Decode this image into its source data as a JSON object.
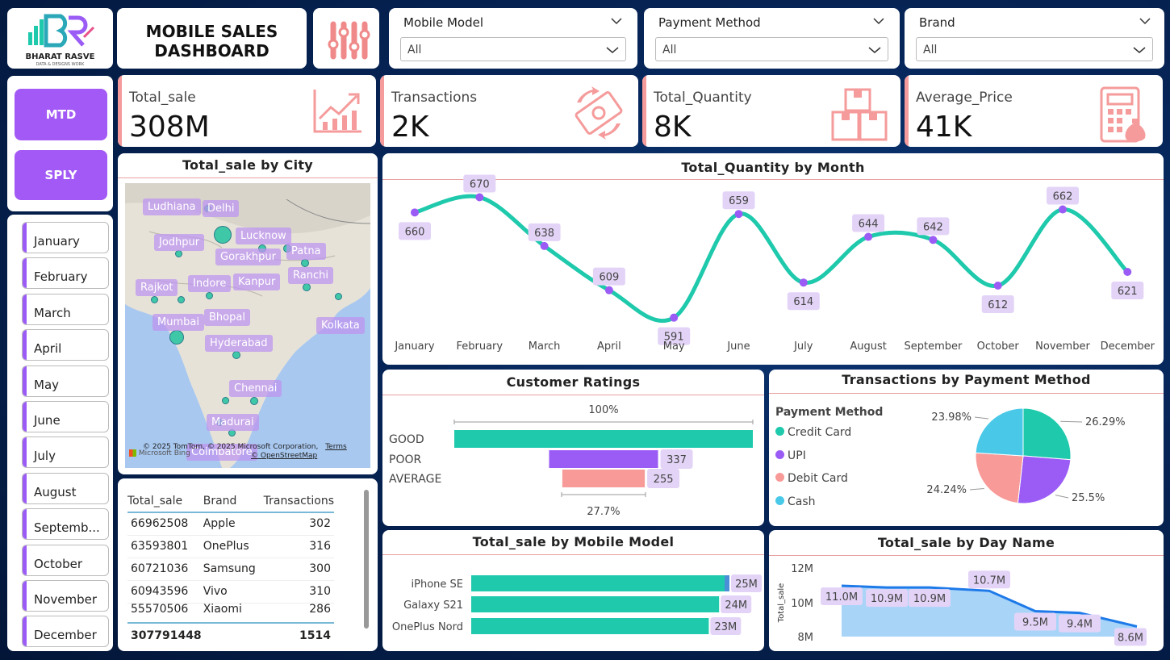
{
  "logo": {
    "brand": "BHARAT RASVE",
    "tagline": "DATA & DESIGNS WORK"
  },
  "header": {
    "title_line1": "MOBILE SALES",
    "title_line2": "DASHBOARD"
  },
  "filters": [
    {
      "label": "Mobile Model",
      "value": "All"
    },
    {
      "label": "Payment Method",
      "value": "All"
    },
    {
      "label": "Brand",
      "value": "All"
    }
  ],
  "buttons": {
    "mtd": "MTD",
    "sply": "SPLY"
  },
  "kpis": [
    {
      "name": "Total_sale",
      "value": "308M"
    },
    {
      "name": "Transactions",
      "value": "2K"
    },
    {
      "name": "Total_Quantity",
      "value": "8K"
    },
    {
      "name": "Average_Price",
      "value": "41K"
    }
  ],
  "months": [
    "January",
    "February",
    "March",
    "April",
    "May",
    "June",
    "July",
    "August",
    "Septemb...",
    "October",
    "November",
    "December"
  ],
  "map": {
    "title": "Total_sale by City",
    "cities": [
      "Ludhiana",
      "Delhi",
      "Jodhpur",
      "Lucknow",
      "Gorakhpur",
      "Patna",
      "Rajkot",
      "Indore",
      "Kanpur",
      "Ranchi",
      "Mumbai",
      "Bhopal",
      "Kolkata",
      "Hyderabad",
      "Chennai",
      "Madurai",
      "Coimbatore"
    ],
    "copyright": "© 2025 TomTom, © 2025 Microsoft Corporation,",
    "terms": "Terms",
    "osm": "© OpenStreetMap",
    "bing": "Microsoft Bing"
  },
  "table": {
    "headers": [
      "Total_sale",
      "Brand",
      "Transactions"
    ],
    "rows": [
      [
        "66962508",
        "Apple",
        "302"
      ],
      [
        "63593801",
        "OnePlus",
        "316"
      ],
      [
        "60721036",
        "Samsung",
        "300"
      ],
      [
        "60943596",
        "Vivo",
        "310"
      ],
      [
        "55570506",
        "Xiaomi",
        "286"
      ]
    ],
    "total": [
      "307791448",
      "",
      "1514"
    ]
  },
  "chart_data": [
    {
      "type": "line",
      "title": "Total_Quantity by Month",
      "categories": [
        "January",
        "February",
        "March",
        "April",
        "May",
        "June",
        "July",
        "August",
        "September",
        "October",
        "November",
        "December"
      ],
      "values": [
        660,
        670,
        638,
        609,
        591,
        659,
        614,
        644,
        642,
        612,
        662,
        621
      ]
    },
    {
      "type": "bar",
      "title": "Customer Ratings",
      "categories": [
        "GOOD",
        "POOR",
        "AVERAGE"
      ],
      "values": [
        null,
        337,
        255
      ],
      "top_label": "100%",
      "bottom_label": "27.7%"
    },
    {
      "type": "pie",
      "title": "Transactions by Payment Method",
      "legend_title": "Payment Method",
      "categories": [
        "Credit Card",
        "UPI",
        "Debit Card",
        "Cash"
      ],
      "values": [
        26.29,
        25.5,
        24.24,
        23.98
      ],
      "labels": [
        "26.29%",
        "25.5%",
        "24.24%",
        "23.98%"
      ],
      "colors": [
        "#1ec9ac",
        "#9b5cf6",
        "#f79a98",
        "#49c8e8"
      ]
    },
    {
      "type": "bar",
      "title": "Total_sale by Mobile Model",
      "categories": [
        "iPhone SE",
        "Galaxy S21",
        "OnePlus Nord"
      ],
      "values": [
        25,
        24,
        23
      ],
      "labels": [
        "25M",
        "24M",
        "23M"
      ]
    },
    {
      "type": "area",
      "title": "Total_sale by Day Name",
      "ylabel": "Total_sale",
      "ticks": [
        "12M",
        "10M",
        "8M"
      ],
      "ylim": [
        8,
        12
      ],
      "values": [
        11.0,
        10.9,
        10.9,
        10.7,
        9.5,
        9.4,
        8.6
      ],
      "labels": [
        "11.0M",
        "10.9M",
        "10.9M",
        "10.7M",
        "9.5M",
        "9.4M",
        "8.6M"
      ]
    }
  ],
  "colors": {
    "accent": "#a259f5",
    "teal": "#1ec9ac",
    "kpi_bar": "#f59b9b",
    "label_bg": "#e3d4f7"
  }
}
